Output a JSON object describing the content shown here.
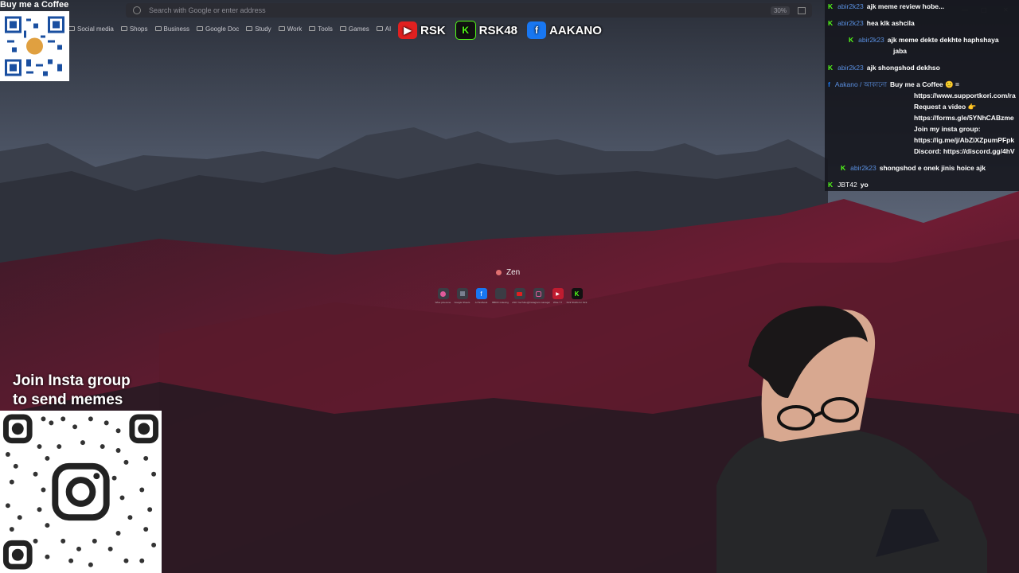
{
  "browser": {
    "address_placeholder": "Search with Google or enter address",
    "zoom": "30%",
    "bookmarks": [
      "Social media",
      "Shops",
      "Business",
      "Google Doc",
      "Study",
      "Work",
      "Tools",
      "Games",
      "AI"
    ]
  },
  "overlay": {
    "coffee_title": "Buy me a Coffee",
    "insta_line1": "Join Insta group",
    "insta_line2": "to send memes",
    "socials": [
      {
        "icon": "youtube-icon",
        "label": "RSK",
        "color": "#e02020"
      },
      {
        "icon": "kick-icon",
        "label": "RSK48",
        "color": "#53fc18"
      },
      {
        "icon": "facebook-icon",
        "label": "AAKANO",
        "color": "#1877f2"
      }
    ]
  },
  "chat": {
    "messages": [
      {
        "user": "abir2k23",
        "text": "ajk meme review hobe..."
      },
      {
        "user": "abir2k23",
        "text": "hea klk ashcila"
      },
      {
        "user": "abir2k23",
        "text": "ajk meme dekte dekhte haphshaya"
      },
      {
        "user": "",
        "text": "jaba"
      },
      {
        "user": "abir2k23",
        "text": "ajk shongshod dekhso"
      },
      {
        "user": "Aakano / আকানো",
        "text": "Buy me a Coffee 🙂 ="
      },
      {
        "user": "",
        "text": "https://www.supportkori.com/ra"
      },
      {
        "user": "",
        "text": "Request a video 👉"
      },
      {
        "user": "",
        "text": "https://forms.gle/5YNhCABzme"
      },
      {
        "user": "",
        "text": "Join my insta group:"
      },
      {
        "user": "",
        "text": "https://ig.me/j/AbZiXZpumPFpk"
      },
      {
        "user": "",
        "text": "Discord: https://discord.gg/4hV"
      },
      {
        "user": "abir2k23",
        "text": "shongshod e onek jinis hoice ajk"
      },
      {
        "user": "JBT42",
        "text": "yo"
      }
    ]
  },
  "newtab": {
    "title": "Zen",
    "shortcuts": [
      "Wise pinecone",
      "Google Sheets",
      "AI Textbook",
      "BBDO indexing",
      "ASK YouTube",
      "@Instagram manager",
      "Wise YT",
      "Kick Studio for Kick"
    ]
  },
  "colors": {
    "kick": "#53fc18",
    "chat_user": "#5a8fe0",
    "youtube": "#e02020",
    "facebook": "#1877f2"
  }
}
